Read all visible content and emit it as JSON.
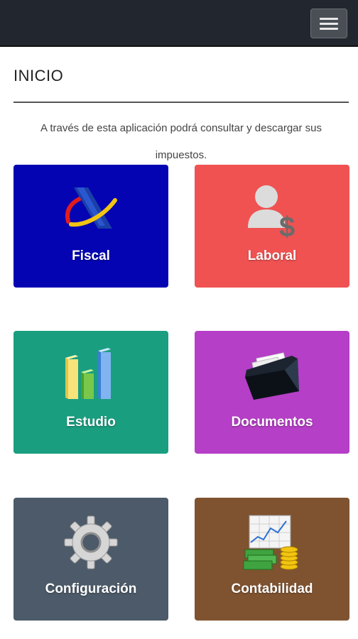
{
  "header": {
    "menu_icon": "hamburger-icon"
  },
  "page": {
    "title": "INICIO",
    "intro": "A través de esta aplicación podrá consultar y descargar sus impuestos."
  },
  "tiles": [
    {
      "label": "Fiscal",
      "icon": "tax-agency-logo-icon",
      "color": "#0404b3"
    },
    {
      "label": "Laboral",
      "icon": "user-dollar-icon",
      "color": "#f05252"
    },
    {
      "label": "Estudio",
      "icon": "bar-chart-icon",
      "color": "#1a9e80"
    },
    {
      "label": "Documentos",
      "icon": "folder-documents-icon",
      "color": "#b53fc6"
    },
    {
      "label": "Configuración",
      "icon": "gear-icon",
      "color": "#4c5a69"
    },
    {
      "label": "Contabilidad",
      "icon": "money-chart-icon",
      "color": "#7f5330"
    }
  ]
}
